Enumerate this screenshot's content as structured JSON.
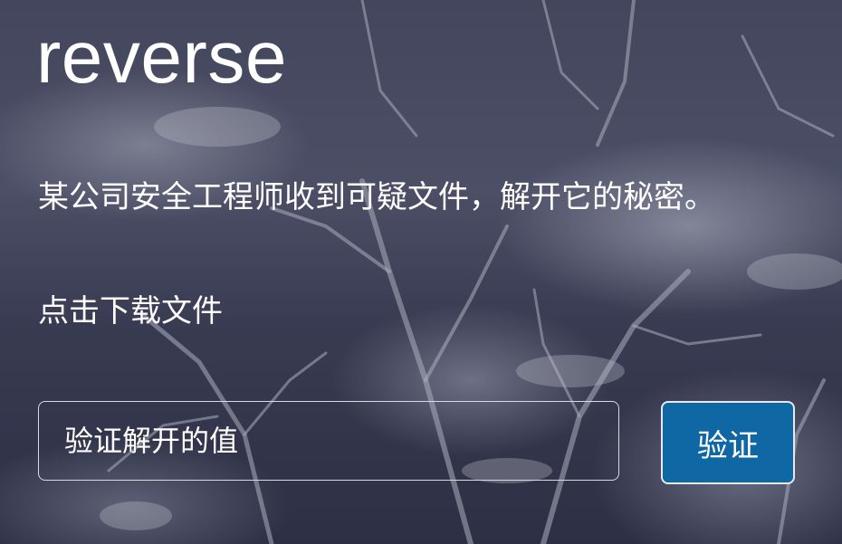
{
  "challenge": {
    "title": "reverse",
    "description": "某公司安全工程师收到可疑文件，解开它的秘密。",
    "download_label": "点击下载文件"
  },
  "form": {
    "answer_placeholder": "验证解开的值",
    "answer_value": "",
    "submit_label": "验证"
  },
  "colors": {
    "submit_button": "#0f68a3",
    "text": "#ffffff",
    "input_border": "#d9dbe3"
  }
}
